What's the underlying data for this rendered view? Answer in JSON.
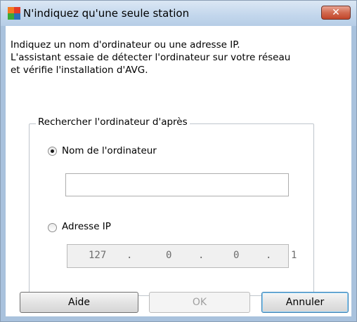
{
  "window": {
    "title": "N'indiquez qu'une seule station",
    "close_glyph": "✕"
  },
  "intro": {
    "line1": "Indiquez un nom d'ordinateur ou une adresse IP.",
    "line2": "L'assistant essaie de détecter l'ordinateur sur votre réseau",
    "line3": "et vérifie l'installation d'AVG."
  },
  "search_group": {
    "legend": "Rechercher l'ordinateur d'après",
    "option_name_label": "Nom de l'ordinateur",
    "option_name_selected": true,
    "computer_name_value": "",
    "option_ip_label": "Adresse IP",
    "option_ip_selected": false,
    "ip_octets": [
      "127",
      "0",
      "0",
      "1"
    ],
    "ip_separator": "."
  },
  "buttons": {
    "help": "Aide",
    "ok": "OK",
    "cancel": "Annuler"
  },
  "icons": {
    "app": "avg-logo-icon",
    "close": "close-icon"
  },
  "colors": {
    "titlebar": "#c2d6ec",
    "close_button": "#c1452a",
    "avg_orange": "#f47a20",
    "avg_green": "#3aa935",
    "avg_blue": "#2a6fb8"
  }
}
